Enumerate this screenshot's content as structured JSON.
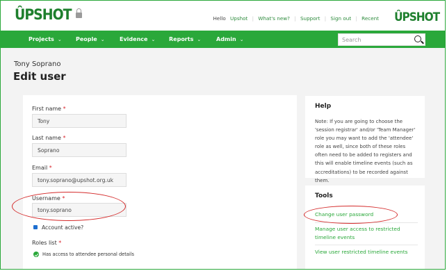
{
  "header": {
    "logo_text": "ÛPSHOT",
    "greeting": "Hello",
    "user": "Upshot",
    "links": [
      "What's new?",
      "Support",
      "Sign out",
      "Recent"
    ],
    "logo_right": "ÛPSHOT"
  },
  "nav": {
    "items": [
      "Projects",
      "People",
      "Evidence",
      "Reports",
      "Admin"
    ],
    "search_placeholder": "Search"
  },
  "page": {
    "subtitle": "Tony Soprano",
    "title": "Edit user"
  },
  "form": {
    "first_name_label": "First name",
    "first_name_value": "Tony",
    "last_name_label": "Last name",
    "last_name_value": "Soprano",
    "email_label": "Email",
    "email_value": "tony.soprano@upshot.org.uk",
    "username_label": "Username",
    "username_value": "tony.soprano",
    "account_active_label": "Account active?",
    "roles_label": "Roles list",
    "role_item": "Has access to attendee personal details",
    "required_mark": "*"
  },
  "help": {
    "title": "Help",
    "text": "Note: If you are going to choose the 'session registrar' and/or 'Team Manager' role you may want to add the 'attendee' role as well, since both of these roles often need to be added to registers and this will enable timeline events (such as accreditations) to be recorded against them."
  },
  "tools": {
    "title": "Tools",
    "links": [
      "Change user password",
      "Manage user access to restricted timeline events",
      "View user restricted timeline events"
    ]
  },
  "colors": {
    "brand_green": "#2aa83a",
    "dark_green": "#1e7f2d",
    "annotation_red": "#d42a2a"
  }
}
